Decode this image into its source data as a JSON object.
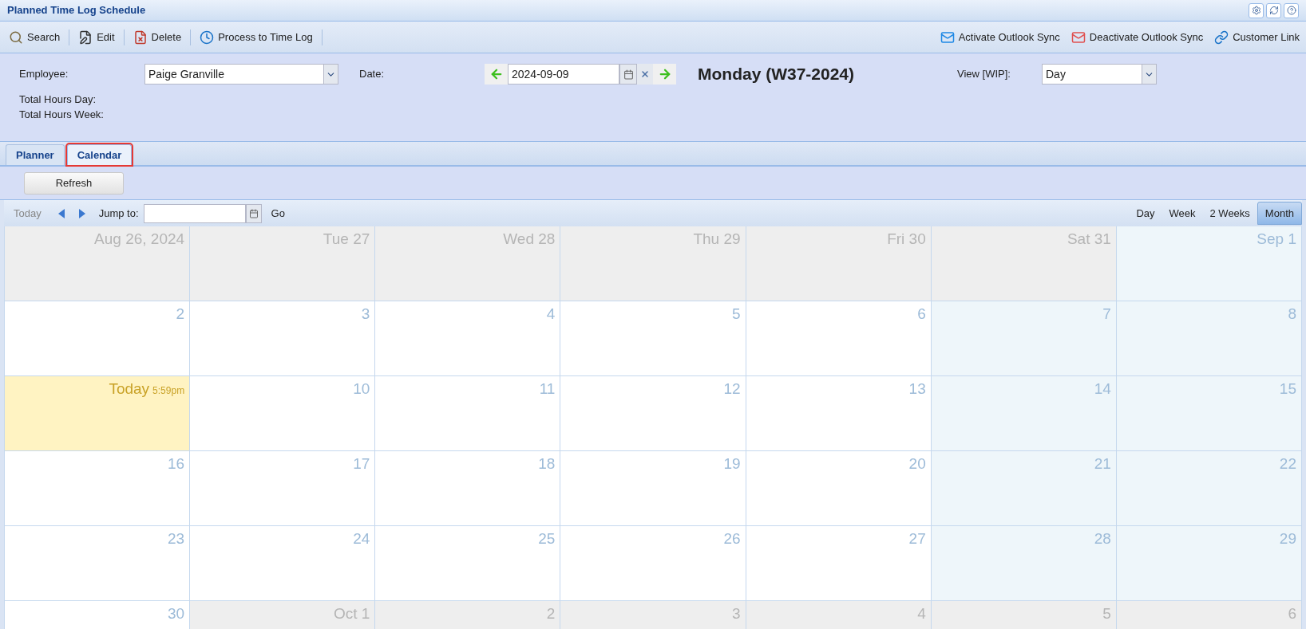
{
  "window": {
    "title": "Planned Time Log Schedule"
  },
  "toolbar": {
    "left": [
      {
        "label": "Search"
      },
      {
        "label": "Edit"
      },
      {
        "label": "Delete"
      },
      {
        "label": "Process to Time Log"
      }
    ],
    "right": [
      {
        "label": "Activate Outlook Sync"
      },
      {
        "label": "Deactivate Outlook Sync"
      },
      {
        "label": "Customer Link"
      }
    ]
  },
  "form": {
    "employee": {
      "label": "Employee:",
      "value": "Paige Granville"
    },
    "date": {
      "label": "Date:",
      "value": "2024-09-09"
    },
    "day_heading": "Monday (W37-2024)",
    "view": {
      "label": "View [WIP]:",
      "value": "Day"
    },
    "totals": [
      "Total Hours Day:",
      "Total Hours Week:"
    ]
  },
  "tabs": [
    {
      "label": "Planner",
      "selected": false
    },
    {
      "label": "Calendar",
      "selected": true
    }
  ],
  "refresh_button": "Refresh",
  "calendar": {
    "today_button": "Today",
    "jump_label": "Jump to:",
    "go_button": "Go",
    "views": [
      {
        "label": "Day",
        "selected": false
      },
      {
        "label": "Week",
        "selected": false
      },
      {
        "label": "2 Weeks",
        "selected": false
      },
      {
        "label": "Month",
        "selected": true
      }
    ],
    "weeks": [
      [
        {
          "label": "Aug 26, 2024",
          "kind": "other"
        },
        {
          "label": "Tue 27",
          "kind": "other"
        },
        {
          "label": "Wed 28",
          "kind": "other"
        },
        {
          "label": "Thu 29",
          "kind": "other"
        },
        {
          "label": "Fri 30",
          "kind": "other"
        },
        {
          "label": "Sat 31",
          "kind": "other"
        },
        {
          "label": "Sep 1",
          "kind": "weekend"
        }
      ],
      [
        {
          "label": "2",
          "kind": "normal"
        },
        {
          "label": "3",
          "kind": "normal"
        },
        {
          "label": "4",
          "kind": "normal"
        },
        {
          "label": "5",
          "kind": "normal"
        },
        {
          "label": "6",
          "kind": "normal"
        },
        {
          "label": "7",
          "kind": "weekend"
        },
        {
          "label": "8",
          "kind": "weekend"
        }
      ],
      [
        {
          "label": "Today",
          "kind": "today",
          "time": "5:59pm"
        },
        {
          "label": "10",
          "kind": "normal"
        },
        {
          "label": "11",
          "kind": "normal"
        },
        {
          "label": "12",
          "kind": "normal"
        },
        {
          "label": "13",
          "kind": "normal"
        },
        {
          "label": "14",
          "kind": "weekend"
        },
        {
          "label": "15",
          "kind": "weekend"
        }
      ],
      [
        {
          "label": "16",
          "kind": "normal"
        },
        {
          "label": "17",
          "kind": "normal"
        },
        {
          "label": "18",
          "kind": "normal"
        },
        {
          "label": "19",
          "kind": "normal"
        },
        {
          "label": "20",
          "kind": "normal"
        },
        {
          "label": "21",
          "kind": "weekend"
        },
        {
          "label": "22",
          "kind": "weekend"
        }
      ],
      [
        {
          "label": "23",
          "kind": "normal"
        },
        {
          "label": "24",
          "kind": "normal"
        },
        {
          "label": "25",
          "kind": "normal"
        },
        {
          "label": "26",
          "kind": "normal"
        },
        {
          "label": "27",
          "kind": "normal"
        },
        {
          "label": "28",
          "kind": "weekend"
        },
        {
          "label": "29",
          "kind": "weekend"
        }
      ],
      [
        {
          "label": "30",
          "kind": "normal"
        },
        {
          "label": "Oct 1",
          "kind": "other"
        },
        {
          "label": "2",
          "kind": "other"
        },
        {
          "label": "3",
          "kind": "other"
        },
        {
          "label": "4",
          "kind": "other"
        },
        {
          "label": "5",
          "kind": "other"
        },
        {
          "label": "6",
          "kind": "other"
        }
      ]
    ]
  }
}
